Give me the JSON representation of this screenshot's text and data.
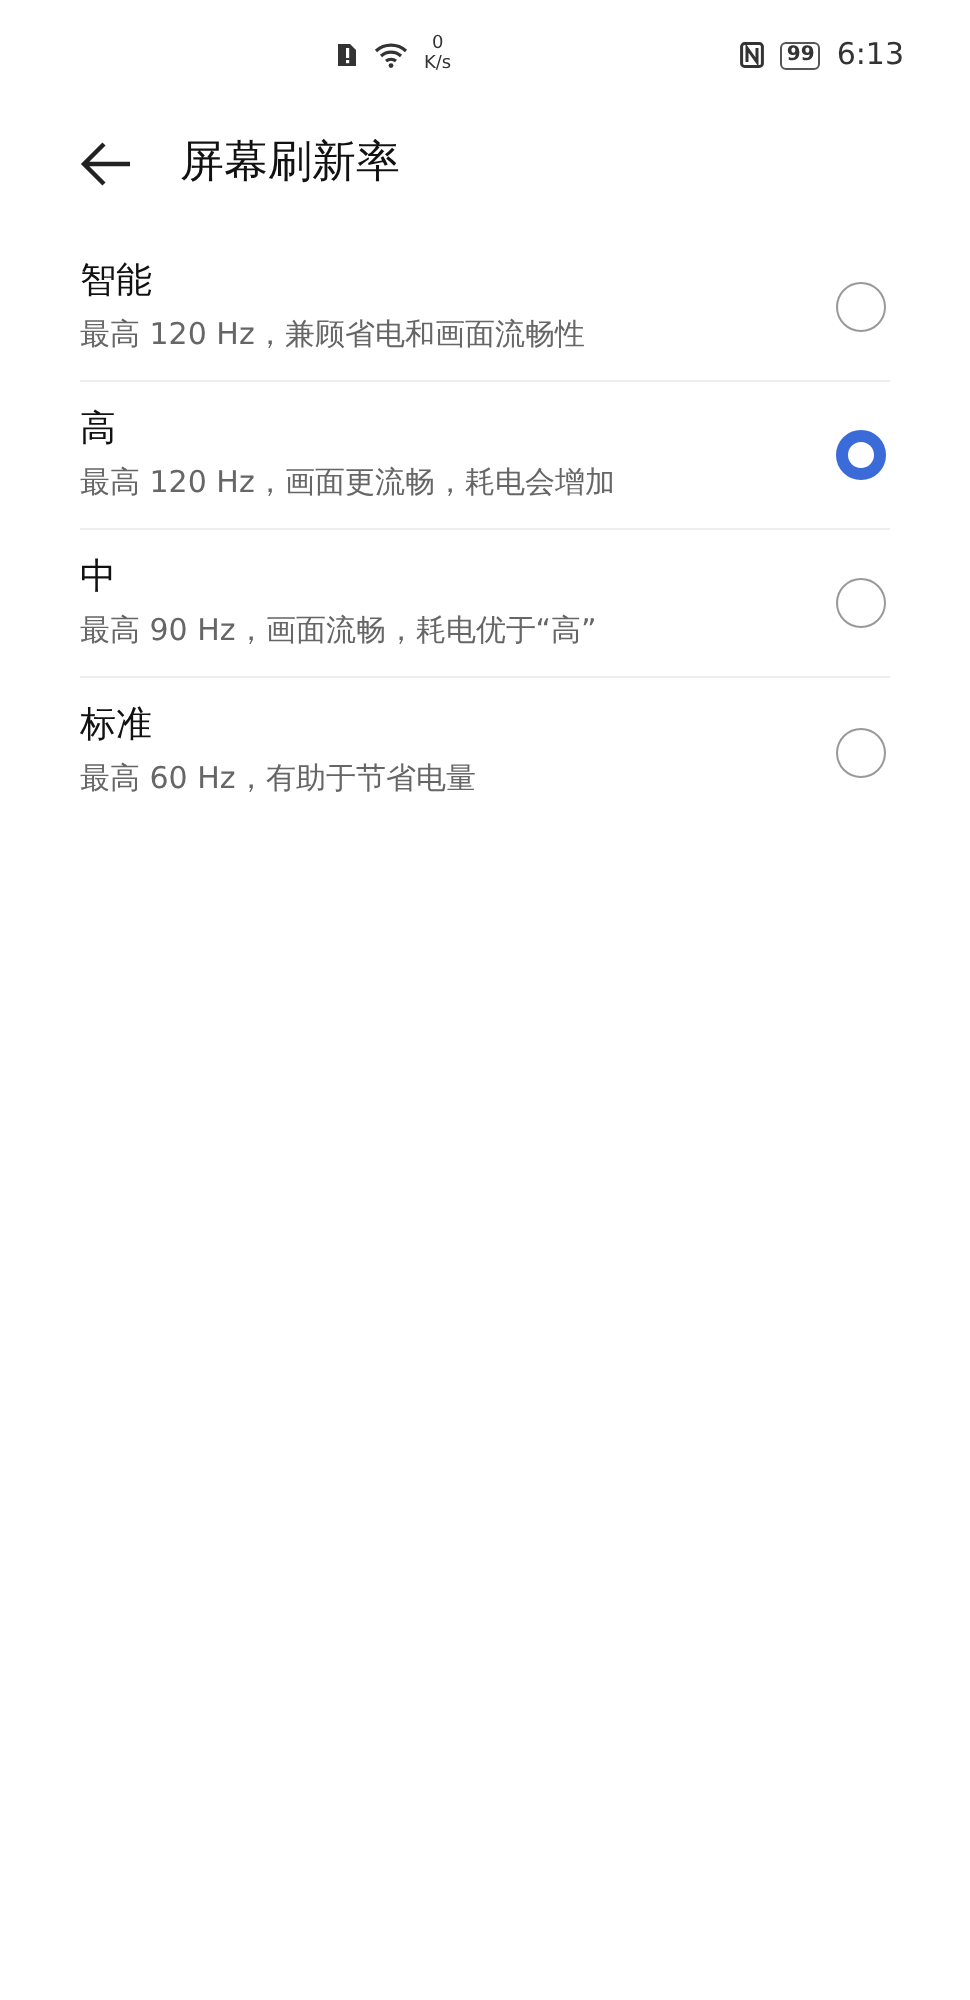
{
  "status_bar": {
    "speed_value": "0",
    "speed_unit": "K/s",
    "battery": "99",
    "time": "6:13"
  },
  "header": {
    "title": "屏幕刷新率"
  },
  "options": [
    {
      "title": "智能",
      "description": "最高 120 Hz，兼顾省电和画面流畅性",
      "selected": false
    },
    {
      "title": "高",
      "description": "最高 120 Hz，画面更流畅，耗电会增加",
      "selected": true
    },
    {
      "title": "中",
      "description": "最高 90 Hz，画面流畅，耗电优于“高”",
      "selected": false
    },
    {
      "title": "标准",
      "description": "最高 60 Hz，有助于节省电量",
      "selected": false
    }
  ]
}
